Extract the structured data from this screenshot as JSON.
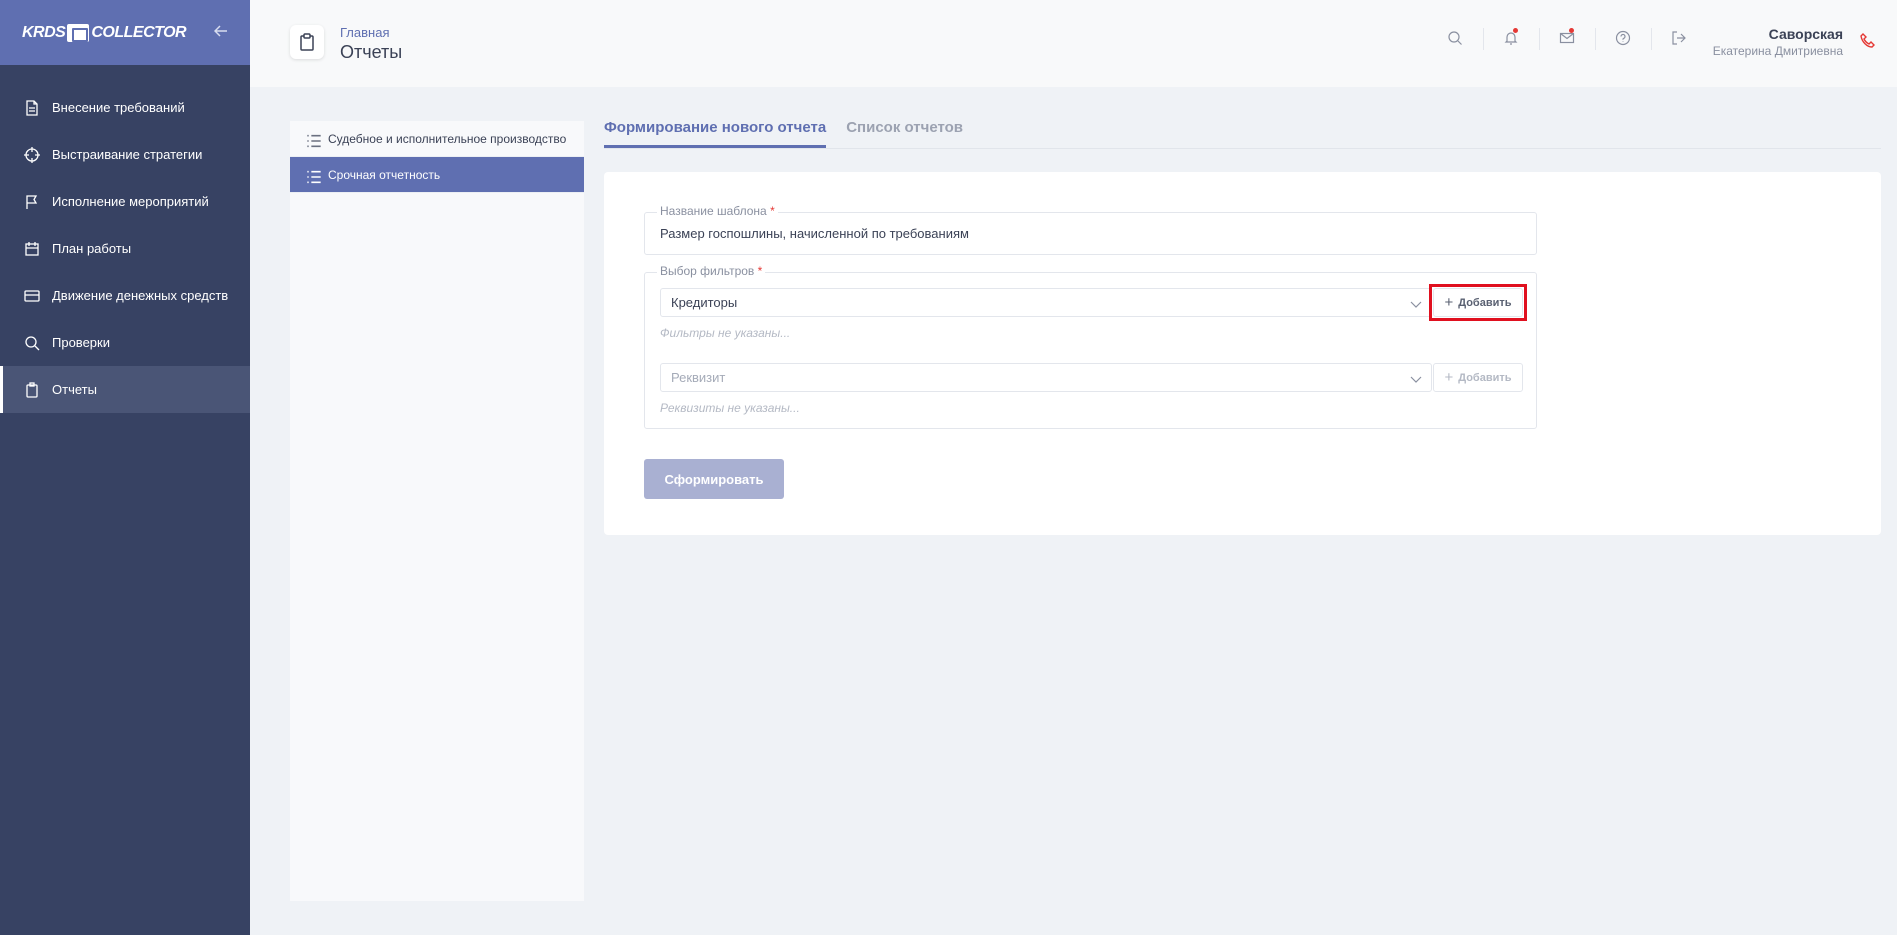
{
  "sidebar": {
    "logo_left": "KRDS",
    "logo_right": "COLLECTOR",
    "items": [
      {
        "label": "Внесение требований",
        "icon": "document-icon"
      },
      {
        "label": "Выстраивание стратегии",
        "icon": "crosshair-icon"
      },
      {
        "label": "Исполнение мероприятий",
        "icon": "flag-icon"
      },
      {
        "label": "План работы",
        "icon": "calendar-icon"
      },
      {
        "label": "Движение денежных средств",
        "icon": "credit-card-icon"
      },
      {
        "label": "Проверки",
        "icon": "search-icon"
      },
      {
        "label": "Отчеты",
        "icon": "clipboard-icon"
      }
    ]
  },
  "header": {
    "breadcrumb_home": "Главная",
    "title": "Отчеты",
    "user_last_name": "Саворская",
    "user_first_name": "Екатерина Дмитриевна"
  },
  "submenu": {
    "items": [
      {
        "label": "Судебное и исполнительное производство"
      },
      {
        "label": "Срочная отчетность"
      }
    ]
  },
  "tabs": [
    {
      "label": "Формирование нового отчета"
    },
    {
      "label": "Список отчетов"
    }
  ],
  "form": {
    "name_label": "Название шаблона",
    "name_value": "Размер госпошлины, начисленной по требованиям",
    "filters_label": "Выбор фильтров",
    "required_mark": "*",
    "filter_select_value": "Кредиторы",
    "add_label": "Добавить",
    "filters_empty": "Фильтры не указаны...",
    "requisite_placeholder": "Реквизит",
    "requisites_empty": "Реквизиты не указаны...",
    "submit_label": "Сформировать"
  },
  "colors": {
    "accent": "#5f6fb1",
    "sidebar": "#374263",
    "highlight": "#e0101f"
  }
}
